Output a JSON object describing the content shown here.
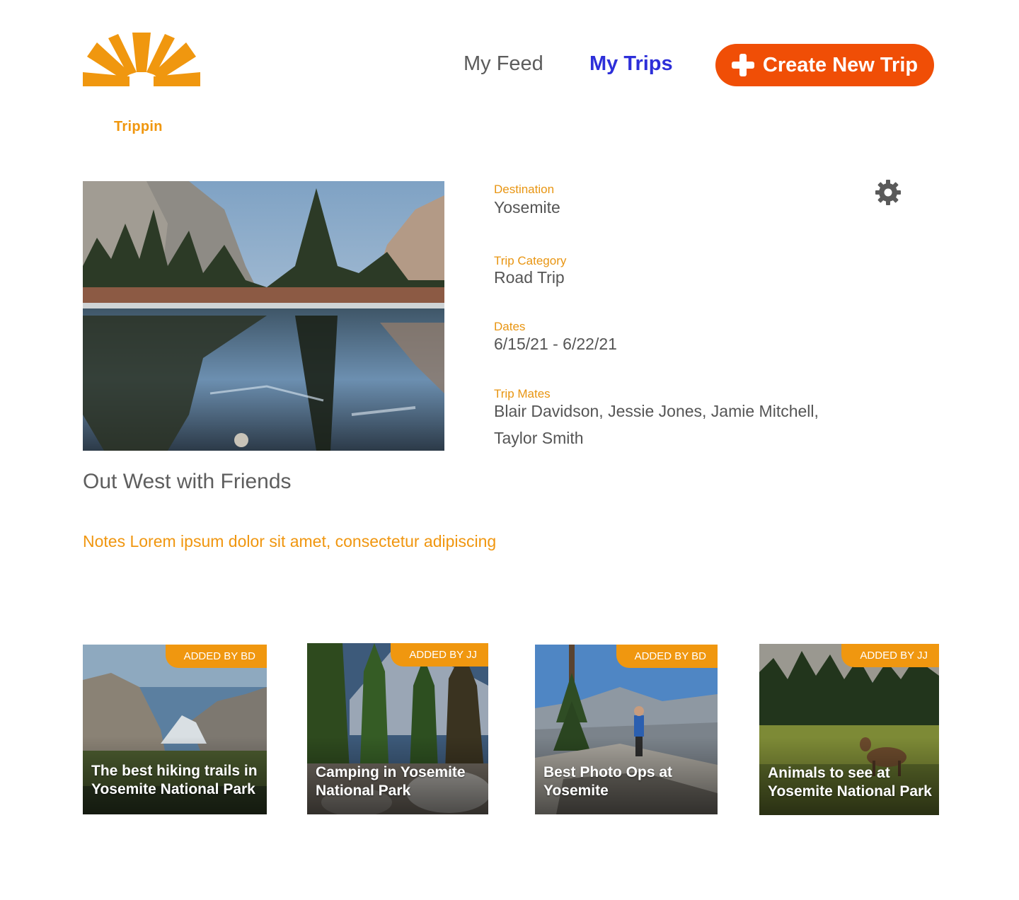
{
  "header": {
    "logo_text": "Trippin",
    "nav": {
      "feed_label": "My Feed",
      "trips_label": "My Trips"
    },
    "create_button_label": "Create New Trip"
  },
  "colors": {
    "brand_orange": "#f0970f",
    "button_orange": "#f04e06",
    "active_nav_blue": "#2d2fd9",
    "text_gray": "#555555"
  },
  "trip": {
    "title": "Out West with Friends",
    "notes": "Notes Lorem ipsum dolor sit amet, consectetur adipiscing",
    "details": {
      "destination_label": "Destination",
      "destination": "Yosemite",
      "category_label": "Trip Category",
      "category": "Road Trip",
      "dates_label": "Dates",
      "dates": "6/15/21 - 6/22/21",
      "mates_label": "Trip Mates",
      "mates_line1": "Blair Davidson, Jessie Jones, Jamie Mitchell,",
      "mates_line2": "Taylor Smith"
    },
    "settings_icon": "gear-icon"
  },
  "cards": [
    {
      "badge": "ADDED BY BD",
      "title": "The best hiking trails in Yosemite National Park"
    },
    {
      "badge": "ADDED BY JJ",
      "title": "Camping in Yosemite National Park"
    },
    {
      "badge": "ADDED BY BD",
      "title": "Best Photo Ops at Yosemite"
    },
    {
      "badge": "ADDED BY JJ",
      "title": "Animals to see at Yosemite National Park"
    }
  ]
}
